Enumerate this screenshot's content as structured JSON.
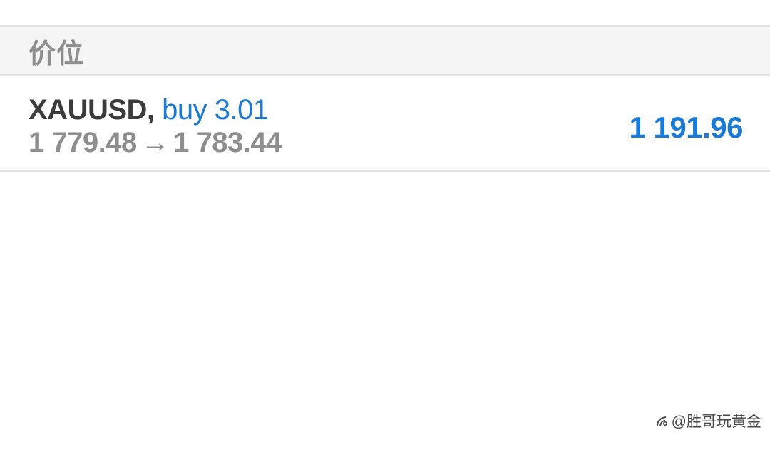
{
  "section": {
    "title": "价位"
  },
  "positions": [
    {
      "symbol": "XAUUSD,",
      "side_volume": "buy 3.01",
      "open_price": "1 779.48",
      "arrow": "→",
      "current_price": "1 783.44",
      "profit": "1 191.96"
    }
  ],
  "watermark": {
    "icon": "platform-logo-icon",
    "text": "@胜哥玩黄金"
  },
  "colors": {
    "accent_blue": "#1a7ad6",
    "symbol_text": "#3b3b3b",
    "muted_text": "#8e8e8e",
    "header_bg": "#f5f5f5",
    "divider": "#e2e2e2"
  }
}
